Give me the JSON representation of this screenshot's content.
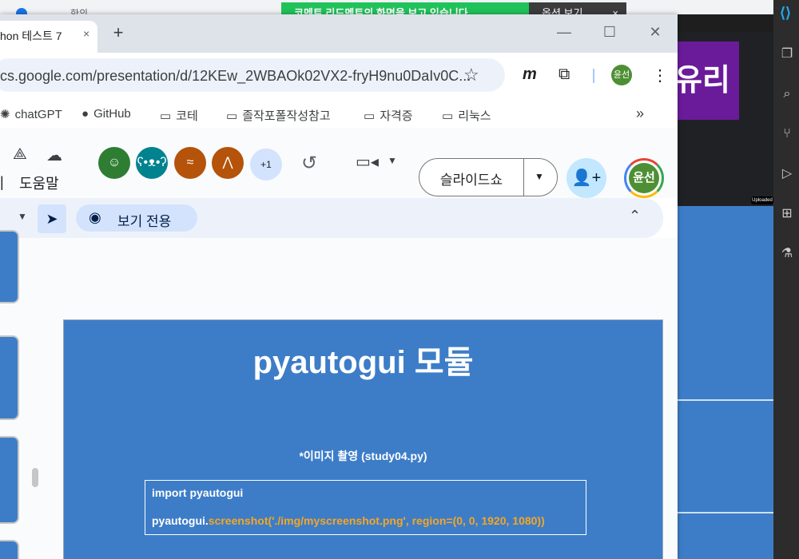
{
  "background": {
    "browser_tab_fragment": "한의",
    "notification": {
      "text": "코멘트 리드멘트의 화면을 보고 있습니다",
      "side_label": "옵션 보기",
      "close": "×"
    },
    "purple_text": "유리",
    "chip_text": "Uploaded"
  },
  "window": {
    "tab_title": "hon 테스트 7",
    "tab_close": "×",
    "new_tab": "+",
    "controls": {
      "minimize": "—",
      "maximize": "☐",
      "close": "✕"
    }
  },
  "toolbar": {
    "url": "cs.google.com/presentation/d/12KEw_2WBAOk02VX2-fryH9nu0DaIv0C...",
    "star": "☆",
    "ext_m": "m",
    "ext_puzzle": "⧉",
    "profile": "윤선",
    "menu": "⋮"
  },
  "bookmarks": {
    "items": [
      {
        "label": "chatGPT",
        "icon": "openai-icon"
      },
      {
        "label": "GitHub",
        "icon": "github-icon"
      },
      {
        "label": "코테",
        "icon": "folder-icon"
      },
      {
        "label": "졸작포폴작성참고",
        "icon": "folder-icon"
      },
      {
        "label": "자격증",
        "icon": "folder-icon"
      },
      {
        "label": "리눅스",
        "icon": "folder-icon"
      }
    ],
    "more": "»"
  },
  "appbar": {
    "help_label": "도움말",
    "collaborators_more": "+1",
    "slideshow_label": "슬라이드쇼",
    "owner_initials": "윤선"
  },
  "menubar": {
    "view_only_label": "보기 전용"
  },
  "slide": {
    "title": "pyautogui 모듈",
    "subtitle": "*이미지 촬영 (study04.py)",
    "code_line1": "import pyautogui",
    "code_line2_prefix": "pyautogui.",
    "code_line2_call": "screenshot('./img/myscreenshot.png', region=(0, 0, 1920, 1080))"
  },
  "colors": {
    "slide_bg": "#3d7dc8",
    "code_highlight": "#f5a623",
    "profile_green": "#4e8f34"
  }
}
